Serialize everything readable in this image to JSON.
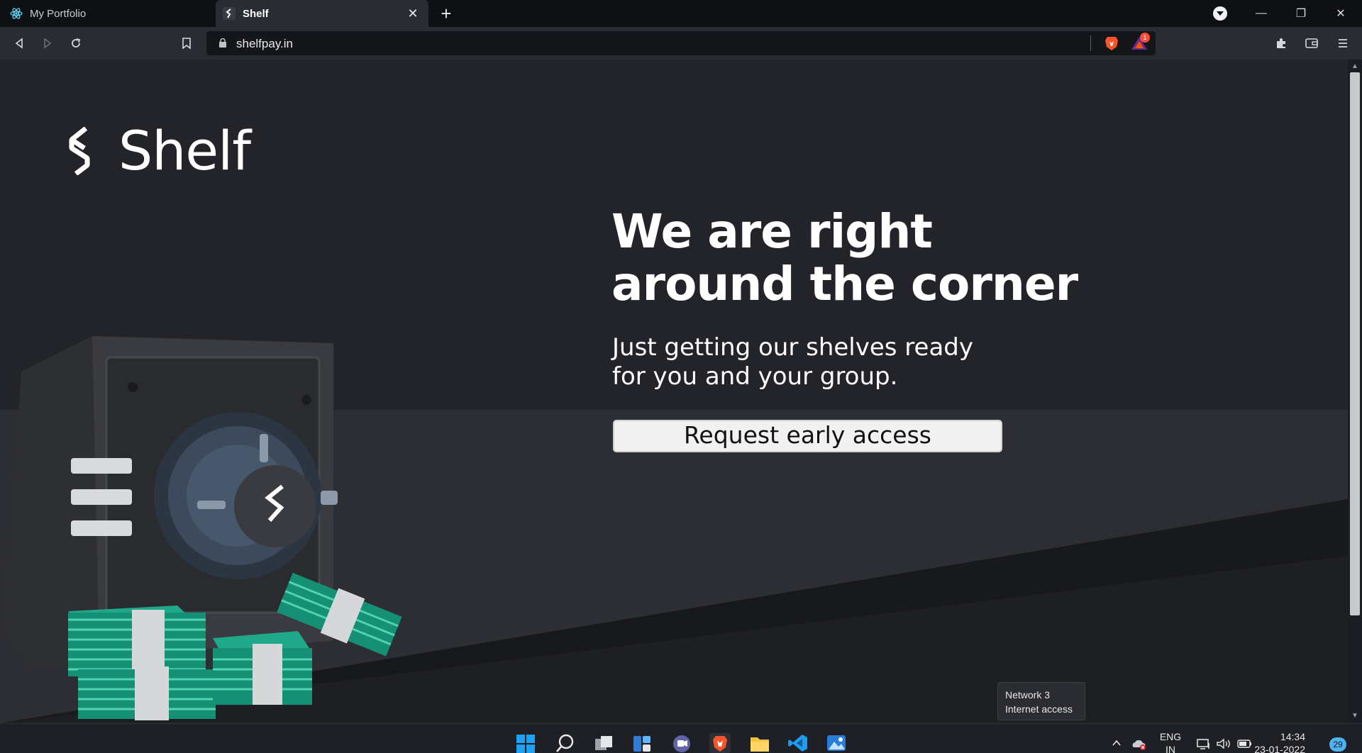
{
  "browser": {
    "tabs": [
      {
        "title": "My Portfolio",
        "favicon": "react-icon",
        "active": false
      },
      {
        "title": "Shelf",
        "favicon": "shelf-favicon",
        "active": true
      }
    ],
    "new_tab": "+",
    "url": "shelfpay.in",
    "bat_badge": "1",
    "colors": {
      "titlebar": "#0f1014",
      "toolbar": "#2a2c33",
      "urlbar": "#15161a",
      "badge": "#ff4b38"
    }
  },
  "page": {
    "brand": "Shelf",
    "headline_line1": "We are right",
    "headline_line2": "around the corner",
    "subline_line1": "Just getting our shelves ready",
    "subline_line2": "for you and your group.",
    "cta": "Request early access",
    "colors": {
      "background": "#232429",
      "text": "#ffffff",
      "button": "#f1f1f1",
      "cash": "#1fa98a"
    }
  },
  "tooltip": {
    "line1": "Network 3",
    "line2": "Internet access"
  },
  "taskbar": {
    "language_line1": "ENG",
    "language_line2": "IN",
    "time": "14:34",
    "date": "23-01-2022",
    "notifications": "29",
    "apps": [
      "start-icon",
      "search-icon",
      "task-view-icon",
      "widgets-icon",
      "teams-chat-icon",
      "brave-icon",
      "file-explorer-icon",
      "vscode-icon",
      "photos-icon"
    ]
  }
}
